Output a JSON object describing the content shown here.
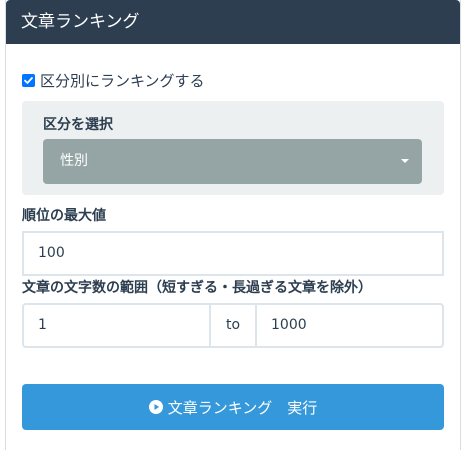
{
  "panel": {
    "title": "文章ランキング"
  },
  "category_toggle": {
    "label": "区分別にランキングする",
    "checked": true
  },
  "category": {
    "label": "区分を選択",
    "selected": "性別"
  },
  "max_rank": {
    "label": "順位の最大値",
    "value": "100"
  },
  "char_range": {
    "label": "文章の文字数の範囲（短すぎる・長過ぎる文章を除外）",
    "min": "1",
    "separator": "to",
    "max": "1000"
  },
  "run_button": {
    "label": "文章ランキング　実行",
    "icon": "play-circle-icon"
  },
  "colors": {
    "header": "#2c3e50",
    "primary": "#3498db",
    "select": "#95a5a6",
    "well": "#ecf0f1"
  }
}
